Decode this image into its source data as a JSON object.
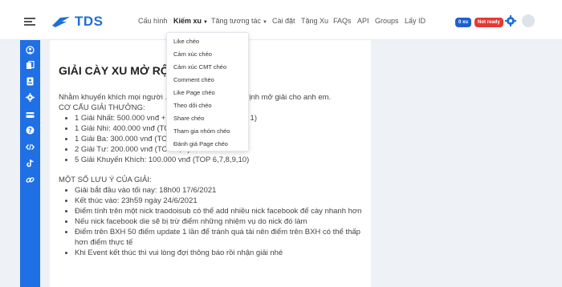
{
  "brand": {
    "name": "TDS"
  },
  "nav": {
    "items": [
      {
        "label": "Cấu hình"
      },
      {
        "label": "Kiếm xu"
      },
      {
        "label": "Tăng tương tác"
      },
      {
        "label": "Cài đặt"
      },
      {
        "label": "Tặng Xu"
      },
      {
        "label": "FAQs"
      },
      {
        "label": "API"
      },
      {
        "label": "Groups"
      },
      {
        "label": "Lấy ID"
      }
    ],
    "balance_badge": "0 xu",
    "status_badge": "Not ready"
  },
  "dropdown": {
    "items": [
      "Like chéo",
      "Cảm xúc chéo",
      "Cảm xúc CMT chéo",
      "Comment chéo",
      "Like Page chéo",
      "Theo dõi chéo",
      "Share chéo",
      "Tham gia nhóm chéo",
      "Đánh giá Page chéo"
    ]
  },
  "sidebar": {
    "icons": [
      "user-icon",
      "copy-icon",
      "id-card-icon",
      "gear-icon",
      "card-icon",
      "question-icon",
      "code-icon",
      "tiktok-icon",
      "link-icon"
    ]
  },
  "article": {
    "title": "GIẢI CÀY XU MỞ RỘNG",
    "intro": "Nhằm khuyến khích mọi người ... viên, nên BQT quyết định mở giải cho anh em.",
    "structure_heading": "CƠ CẤU GIẢI THƯỞNG:",
    "prizes": [
      "1 Giải Nhất: 500.000 vnđ + ... post/ảnh bất kỳ (TOP 1)",
      "1 Giải Nhì: 400.000 vnđ (TOP 2)",
      "1 Giải Ba: 300.000 vnđ (TOP 3)",
      "2 Giải Tư: 200.000 vnđ (TOP 4, 5)",
      "5 Giải Khuyến Khích: 100.000 vnđ (TOP 6,7,8,9,10)"
    ],
    "notes_heading": "MỘT SỐ LƯU Ý CỦA GIẢI:",
    "notes": [
      "Giải bắt đầu vào tối nay: 18h00 17/6/2021",
      "Kết thúc vào: 23h59 ngày 24/6/2021",
      "Điểm tính trên một nick traodoisub có thể add nhiều nick facebook để cày nhanh hơn",
      "Nếu nick facebook die sẽ bị trừ điểm những nhiệm vụ do nick đó làm",
      "Điểm trên BXH 50 điểm update 1 lần để tránh quá tải nên điểm trên BXH có thể thấp hơn điểm thực tế",
      "Khi Event kết thúc thì vui lòng đợi thông báo rồi nhận giải nhé"
    ]
  },
  "colors": {
    "brand": "#1e6fd9",
    "sidebar": "#1f6fe5",
    "badge_xu": "#1e5fd0",
    "badge_notready": "#e53935"
  }
}
